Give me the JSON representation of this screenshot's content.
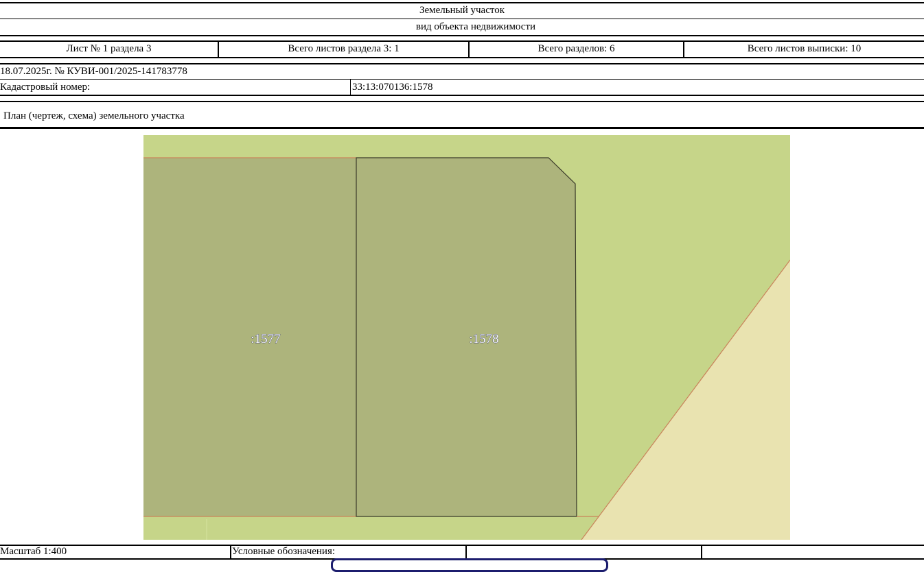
{
  "header": {
    "object_title": "Земельный участок",
    "object_type": "вид объекта недвижимости"
  },
  "sheet_info": {
    "sheet": "Лист № 1 раздела 3",
    "total_sheets_section": "Всего листов раздела 3: 1",
    "total_sections": "Всего разделов: 6",
    "total_sheets_extract": "Всего листов выписки: 10"
  },
  "extract_ref": "18.07.2025г. № КУВИ-001/2025-141783778",
  "cadastral": {
    "label": "Кадастровый номер:",
    "value": "33:13:070136:1578"
  },
  "plan_title": "План (чертеж, схема) земельного участка",
  "map": {
    "parcel_left_label": ":1577",
    "parcel_right_label": ":1578",
    "colors": {
      "background": "#c6d589",
      "parcel": "#adb47c",
      "road": "#e9e3b0",
      "boundary": "#c9835a",
      "outline": "#3a3a2a"
    }
  },
  "footer": {
    "scale": "Масштаб 1:400",
    "legend_label": "Условные обозначения:"
  }
}
